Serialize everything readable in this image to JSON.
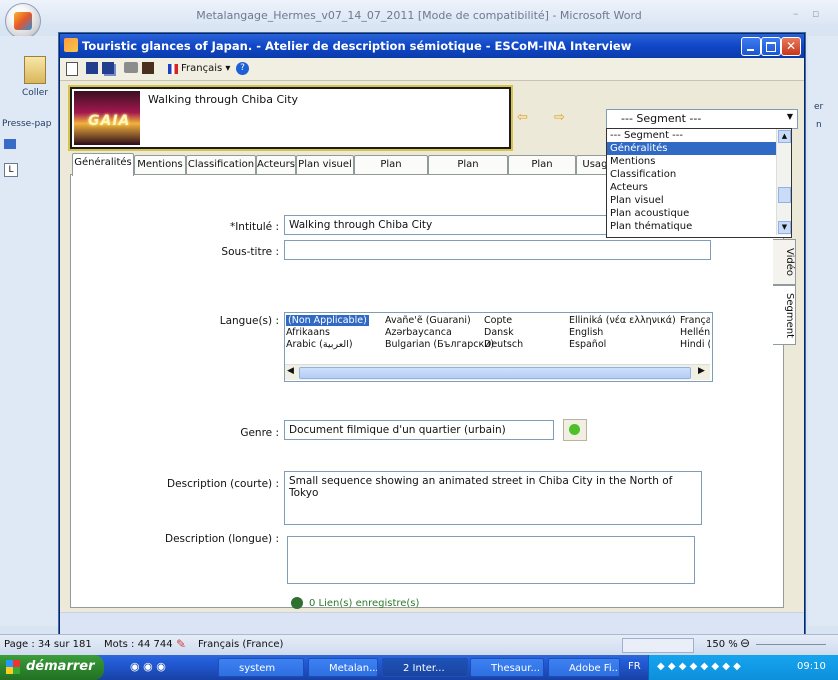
{
  "word": {
    "title": "Metalangage_Hermes_v07_14_07_2011 [Mode de compatibilité] - Microsoft Word",
    "ribbon_paste": "Coller",
    "ribbon_clipboard": "Presse-pap",
    "right_fragment1": "er",
    "right_fragment2": "n"
  },
  "dialog": {
    "title": "Touristic glances of Japan. - Atelier de description sémiotique - ESCoM-INA Interview",
    "language": "Français"
  },
  "video": {
    "thumbnail_text": "GAIA",
    "title": "Walking through Chiba City"
  },
  "segment": {
    "selected": "--- Segment ---",
    "options": [
      "--- Segment ---",
      "Généralités",
      "Mentions",
      "Classification",
      "Acteurs",
      "Plan visuel",
      "Plan acoustique",
      "Plan thématique"
    ],
    "highlighted_index": 1
  },
  "tabs": [
    "Généralités",
    "Mentions",
    "Classification",
    "Acteurs",
    "Plan visuel",
    "Plan acoustique",
    "Plan thématique",
    "Plan discursif",
    "Usage"
  ],
  "side_tabs": [
    "Vidéo",
    "Segment"
  ],
  "form": {
    "intitule_label": "*Intitulé :",
    "intitule_value": "Walking through Chiba City",
    "soustitre_label": "Sous-titre :",
    "soustitre_value": "",
    "langues_label": "Langue(s) :",
    "langues": [
      [
        "(Non Applicable)",
        "Avañe'ẽ (Guarani)",
        "Copte",
        "Elliniká (νέα ελληνικά)",
        "Françai"
      ],
      [
        "Afrikaans",
        "Azərbaycanca",
        "Dansk",
        "English",
        "Hellén"
      ],
      [
        "Arabic (العربية)",
        "Bulgarian (Български)",
        "Deutsch",
        "Español",
        "Hindi ("
      ]
    ],
    "genre_label": "Genre :",
    "genre_value": "Document filmique d'un quartier (urbain)",
    "desc_courte_label": "Description (courte) :",
    "desc_courte_value": "Small sequence showing an animated street in Chiba City in the North of Tokyo",
    "desc_longue_label": "Description (longue) :",
    "desc_longue_value": "",
    "links_text": "0 Lien(s) enregistre(s)"
  },
  "statusbar": {
    "page": "Page : 34 sur 181",
    "words": "Mots : 44 744",
    "language": "Français (France)",
    "zoom": "150 %"
  },
  "taskbar": {
    "start": "démarrer",
    "items": [
      "system",
      "Metalan...",
      "2 Inter...",
      "Thesaur...",
      "Adobe Fi..."
    ],
    "locale": "FR",
    "clock": "09:10"
  }
}
